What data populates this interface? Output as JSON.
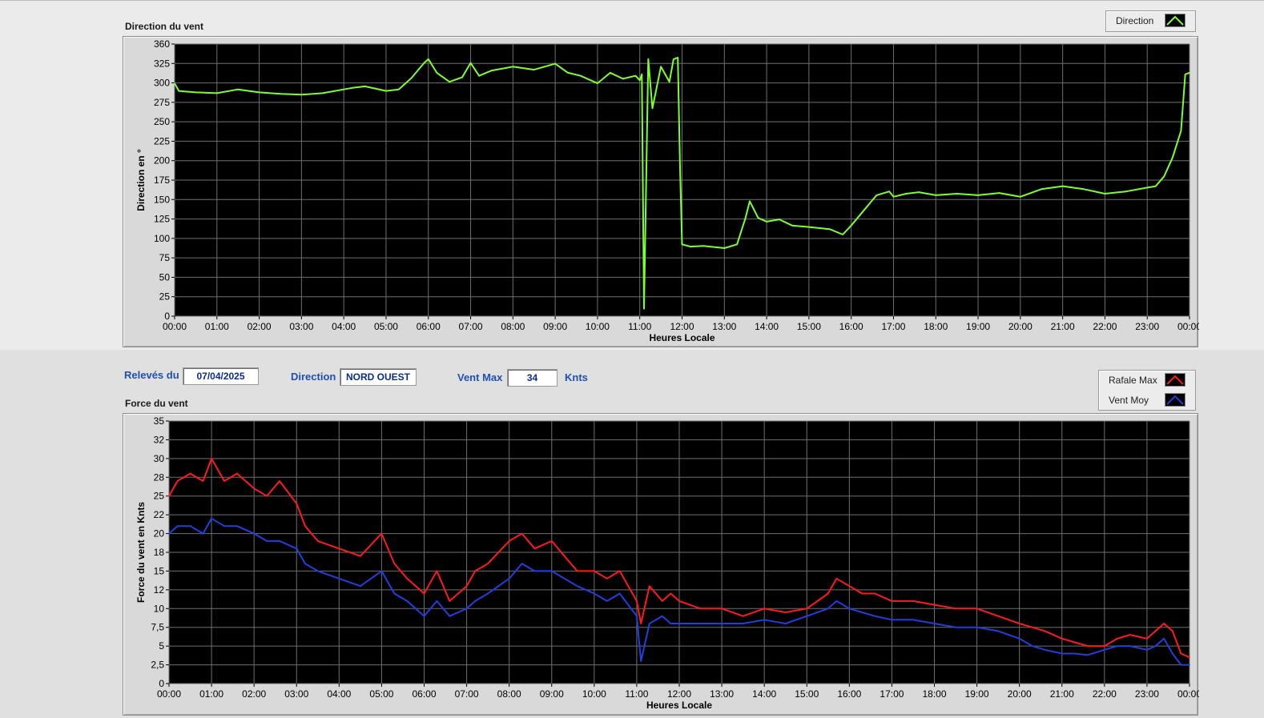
{
  "direction_chart": {
    "title": "Direction du vent",
    "legend": [
      {
        "label": "Direction",
        "color": "#7dff2e"
      }
    ],
    "chart_data": {
      "type": "line",
      "xlabel": "Heures Locale",
      "ylabel": "Direction en °",
      "ylim": [
        0,
        360
      ],
      "yticks": [
        "0",
        "25",
        "50",
        "75",
        "100",
        "125",
        "150",
        "175",
        "200",
        "225",
        "250",
        "275",
        "300",
        "325",
        "360"
      ],
      "xticks": [
        "00:00",
        "01:00",
        "02:00",
        "03:00",
        "04:00",
        "05:00",
        "06:00",
        "07:00",
        "08:00",
        "09:00",
        "10:00",
        "11:00",
        "12:00",
        "13:00",
        "14:00",
        "15:00",
        "16:00",
        "17:00",
        "18:00",
        "19:00",
        "20:00",
        "21:00",
        "22:00",
        "23:00",
        "00:00"
      ],
      "xlim": [
        0,
        24
      ],
      "grid": true,
      "background": "#000000",
      "series": [
        {
          "name": "Direction",
          "color": "#7dff2e",
          "x": [
            0,
            0.1,
            0.5,
            1,
            1.5,
            2,
            2.5,
            3,
            3.5,
            4,
            4.2,
            4.5,
            5,
            5.3,
            5.6,
            5.9,
            6,
            6.2,
            6.5,
            6.8,
            7,
            7.2,
            7.5,
            8,
            8.5,
            9,
            9.3,
            9.6,
            10,
            10.3,
            10.6,
            10.9,
            11,
            11.05,
            11.1,
            11.2,
            11.3,
            11.5,
            11.7,
            11.8,
            11.9,
            11.95,
            12,
            12.2,
            12.5,
            13,
            13.3,
            13.5,
            13.6,
            13.8,
            14,
            14.3,
            14.6,
            15,
            15.5,
            15.8,
            16,
            16.3,
            16.6,
            16.9,
            17,
            17.3,
            17.6,
            18,
            18.5,
            19,
            19.5,
            20,
            20.5,
            21,
            21.5,
            22,
            22.5,
            23,
            23.2,
            23.4,
            23.6,
            23.8,
            23.9,
            24
          ],
          "y": [
            308,
            298,
            296,
            295,
            300,
            296,
            294,
            293,
            295,
            300,
            302,
            304,
            298,
            300,
            315,
            335,
            340,
            322,
            310,
            316,
            335,
            318,
            325,
            330,
            326,
            334,
            322,
            318,
            308,
            322,
            314,
            318,
            312,
            320,
            10,
            340,
            275,
            330,
            310,
            340,
            342,
            200,
            95,
            92,
            93,
            90,
            95,
            130,
            152,
            130,
            125,
            128,
            120,
            118,
            115,
            108,
            120,
            140,
            160,
            165,
            158,
            162,
            164,
            160,
            162,
            160,
            163,
            158,
            168,
            172,
            168,
            162,
            165,
            170,
            172,
            185,
            210,
            245,
            320,
            322
          ]
        }
      ]
    }
  },
  "info_bar": {
    "releves_label": "Relevés du",
    "date": "07/04/2025",
    "direction_label": "Direction",
    "direction_value": "NORD OUEST",
    "ventmax_label": "Vent Max",
    "ventmax_value": "34",
    "ventmax_unit": "Knts"
  },
  "force_chart": {
    "title": "Force du vent",
    "legend": [
      {
        "label": "Rafale Max",
        "color": "#ff1a1a"
      },
      {
        "label": "Vent Moy",
        "color": "#1f3fe0"
      }
    ],
    "chart_data": {
      "type": "line",
      "xlabel": "Heures Locale",
      "ylabel": "Force du vent en Knts",
      "ylim": [
        0,
        35
      ],
      "yticks": [
        "0",
        "2,5",
        "5",
        "7,5",
        "10",
        "12",
        "15",
        "18",
        "20",
        "22",
        "25",
        "28",
        "30",
        "32",
        "35"
      ],
      "xticks": [
        "00:00",
        "01:00",
        "02:00",
        "03:00",
        "04:00",
        "05:00",
        "06:00",
        "07:00",
        "08:00",
        "09:00",
        "10:00",
        "11:00",
        "12:00",
        "13:00",
        "14:00",
        "15:00",
        "16:00",
        "17:00",
        "18:00",
        "19:00",
        "20:00",
        "21:00",
        "22:00",
        "23:00",
        "00:00"
      ],
      "xlim": [
        0,
        24
      ],
      "grid": true,
      "background": "#000000",
      "series": [
        {
          "name": "Rafale Max",
          "color": "#ff1a1a",
          "x": [
            0,
            0.2,
            0.5,
            0.8,
            1,
            1.3,
            1.6,
            2,
            2.3,
            2.6,
            3,
            3.2,
            3.5,
            4,
            4.5,
            5,
            5.3,
            5.6,
            6,
            6.3,
            6.6,
            7,
            7.2,
            7.5,
            8,
            8.3,
            8.6,
            9,
            9.3,
            9.6,
            10,
            10.3,
            10.6,
            11,
            11.1,
            11.3,
            11.6,
            11.8,
            12,
            12.5,
            13,
            13.5,
            14,
            14.5,
            15,
            15.5,
            15.7,
            16,
            16.3,
            16.6,
            17,
            17.5,
            18,
            18.5,
            19,
            19.5,
            20,
            20.3,
            20.6,
            21,
            21.3,
            21.6,
            22,
            22.3,
            22.6,
            23,
            23.2,
            23.4,
            23.6,
            23.8,
            24
          ],
          "y": [
            25,
            27,
            28,
            27,
            30,
            27,
            28,
            26,
            25,
            27,
            24,
            21,
            19,
            18,
            17,
            20,
            16,
            14,
            12,
            15,
            11,
            13,
            15,
            16,
            19,
            20,
            18,
            19,
            17,
            15,
            15,
            14,
            15,
            11,
            8,
            13,
            11,
            12,
            11,
            10,
            10,
            9,
            10,
            9.5,
            10,
            12,
            14,
            13,
            12,
            12,
            11,
            11,
            10.5,
            10,
            10,
            9,
            8,
            7.5,
            7,
            6,
            5.5,
            5,
            5,
            6,
            6.5,
            6,
            7,
            8,
            7,
            4,
            3.5
          ]
        },
        {
          "name": "Vent Moy",
          "color": "#1f3fe0",
          "x": [
            0,
            0.2,
            0.5,
            0.8,
            1,
            1.3,
            1.6,
            2,
            2.3,
            2.6,
            3,
            3.2,
            3.5,
            4,
            4.5,
            5,
            5.3,
            5.6,
            6,
            6.3,
            6.6,
            7,
            7.2,
            7.5,
            8,
            8.3,
            8.6,
            9,
            9.3,
            9.6,
            10,
            10.3,
            10.6,
            11,
            11.1,
            11.3,
            11.6,
            11.8,
            12,
            12.5,
            13,
            13.5,
            14,
            14.5,
            15,
            15.5,
            15.7,
            16,
            16.3,
            16.6,
            17,
            17.5,
            18,
            18.5,
            19,
            19.5,
            20,
            20.3,
            20.6,
            21,
            21.3,
            21.6,
            22,
            22.3,
            22.6,
            23,
            23.2,
            23.4,
            23.6,
            23.8,
            24
          ],
          "y": [
            20,
            21,
            21,
            20,
            22,
            21,
            21,
            20,
            19,
            19,
            18,
            16,
            15,
            14,
            13,
            15,
            12,
            11,
            9,
            11,
            9,
            10,
            11,
            12,
            14,
            16,
            15,
            15,
            14,
            13,
            12,
            11,
            12,
            9,
            3,
            8,
            9,
            8,
            8,
            8,
            8,
            8,
            8.5,
            8,
            9,
            10,
            11,
            10,
            9.5,
            9,
            8.5,
            8.5,
            8,
            7.5,
            7.5,
            7,
            6,
            5,
            4.5,
            4,
            4,
            3.8,
            4.5,
            5,
            5,
            4.5,
            5,
            6,
            4,
            2.5,
            2.5
          ]
        }
      ]
    }
  }
}
